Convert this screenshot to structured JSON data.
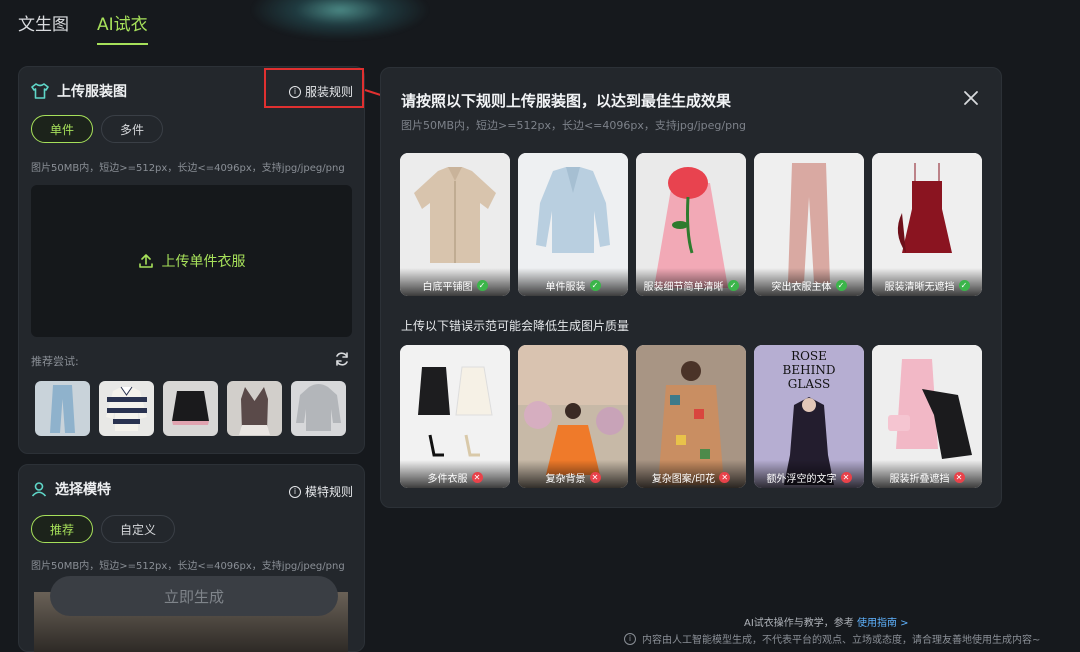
{
  "tabs": [
    {
      "label": "文生图"
    },
    {
      "label": "AI试衣"
    }
  ],
  "upload_panel": {
    "title": "上传服装图",
    "rule_link": "服装规则",
    "modes": [
      "单件",
      "多件"
    ],
    "hint": "图片50MB内，短边>=512px，长边<=4096px，支持jpg/jpeg/png",
    "dropzone_label": "上传单件衣服",
    "try_label": "推荐尝试:"
  },
  "model_panel": {
    "title": "选择模特",
    "rule_link": "模特规则",
    "modes": [
      "推荐",
      "自定义"
    ],
    "hint": "图片50MB内，短边>=512px，长边<=4096px，支持jpg/jpeg/png"
  },
  "generate_button": "立即生成",
  "dialog": {
    "title": "请按照以下规则上传服装图，以达到最佳生成效果",
    "subtitle": "图片50MB内，短边>=512px，长边<=4096px，支持jpg/jpeg/png",
    "good_examples": [
      {
        "label": "白底平铺图"
      },
      {
        "label": "单件服装"
      },
      {
        "label": "服装细节简单清晰"
      },
      {
        "label": "突出衣服主体"
      },
      {
        "label": "服装清晰无遮挡"
      }
    ],
    "bad_section_title": "上传以下错误示范可能会降低生成图片质量",
    "bad_examples": [
      {
        "label": "多件衣服"
      },
      {
        "label": "复杂背景"
      },
      {
        "label": "复杂图案/印花"
      },
      {
        "label": "额外浮空的文字"
      },
      {
        "label": "服装折叠遮挡"
      }
    ],
    "poster_text": [
      "ROSE",
      "BEHIND",
      "GLASS"
    ]
  },
  "footer": {
    "line1_prefix": "AI试衣操作与教学，参考",
    "line1_link": "使用指南 >",
    "line2": "内容由人工智能模型生成，不代表平台的观点、立场或态度，请合理友善地使用生成内容~"
  },
  "colors": {
    "accent": "#a6e05a",
    "ok": "#3bb54a",
    "bad": "#e8424a",
    "annotation": "#e03030"
  }
}
